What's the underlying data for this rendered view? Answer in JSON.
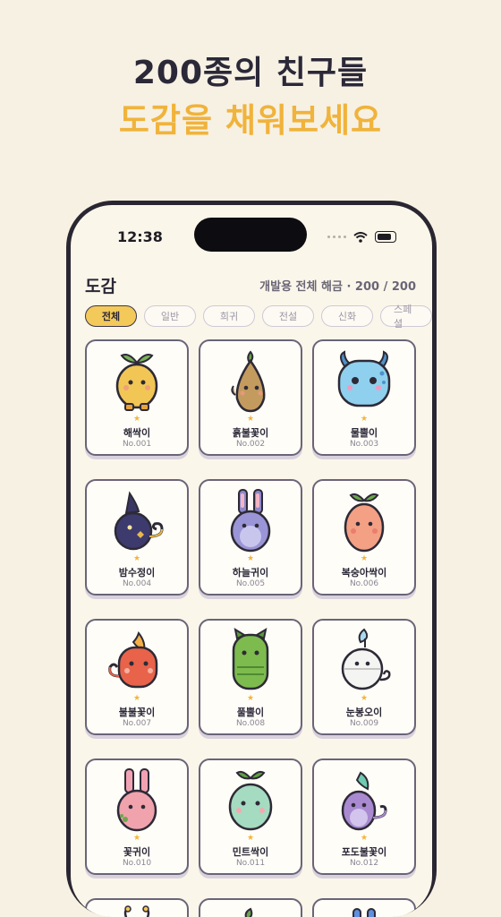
{
  "promo": {
    "line1": "200종의 친구들",
    "line2": "도감을 채워보세요"
  },
  "status_bar": {
    "time": "12:38"
  },
  "header": {
    "title": "도감",
    "count_text": "개발용 전체 해금 · 200 / 200"
  },
  "filters": [
    "전체",
    "일반",
    "희귀",
    "전설",
    "신화",
    "스페셜"
  ],
  "active_filter": "전체",
  "colors": {
    "accent": "#f0b33b",
    "background": "#f7f1e4"
  },
  "creatures": [
    {
      "name": "해싹이",
      "no": "No.001",
      "star": "★",
      "icon": "sprout-creature-icon"
    },
    {
      "name": "흙불꽃이",
      "no": "No.002",
      "star": "★",
      "icon": "seed-creature-icon"
    },
    {
      "name": "물뿔이",
      "no": "No.003",
      "star": "★",
      "icon": "water-creature-icon"
    },
    {
      "name": "밤수정이",
      "no": "No.004",
      "star": "★",
      "icon": "night-creature-icon"
    },
    {
      "name": "하늘귀이",
      "no": "No.005",
      "star": "★",
      "icon": "bunny-creature-icon"
    },
    {
      "name": "복숭아싹이",
      "no": "No.006",
      "star": "★",
      "icon": "peach-creature-icon"
    },
    {
      "name": "불불꽃이",
      "no": "No.007",
      "star": "★",
      "icon": "fire-creature-icon"
    },
    {
      "name": "풀뿔이",
      "no": "No.008",
      "star": "★",
      "icon": "grass-creature-icon"
    },
    {
      "name": "눈봉오이",
      "no": "No.009",
      "star": "★",
      "icon": "snow-creature-icon"
    },
    {
      "name": "꽃귀이",
      "no": "No.010",
      "star": "★",
      "icon": "flower-bunny-icon"
    },
    {
      "name": "민트싹이",
      "no": "No.011",
      "star": "★",
      "icon": "mint-creature-icon"
    },
    {
      "name": "포도불꽃이",
      "no": "No.012",
      "star": "★",
      "icon": "grape-creature-icon"
    }
  ]
}
